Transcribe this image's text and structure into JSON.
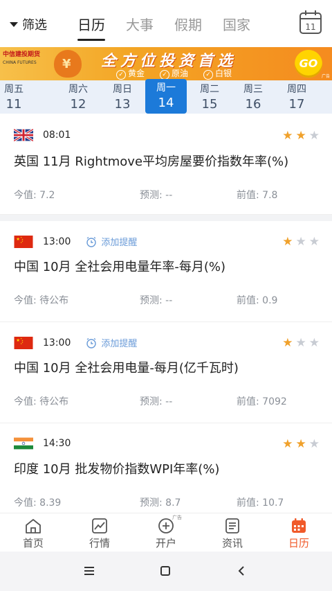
{
  "header": {
    "filter_label": "筛选",
    "tabs": [
      "日历",
      "大事",
      "假期",
      "国家"
    ],
    "calendar_day": "11"
  },
  "banner": {
    "logo_cn": "中信建投期货",
    "logo_en": "CHINA FUTURES",
    "title": "全方位投资首选",
    "tags": [
      "黄金",
      "原油",
      "白银"
    ],
    "go": "GO",
    "ad": "广告"
  },
  "dates": [
    {
      "dow": "周五",
      "day": "11"
    },
    {
      "dow": "周六",
      "day": "12"
    },
    {
      "dow": "周日",
      "day": "13"
    },
    {
      "dow": "周一",
      "day": "14"
    },
    {
      "dow": "周二",
      "day": "15"
    },
    {
      "dow": "周三",
      "day": "16"
    },
    {
      "dow": "周四",
      "day": "17"
    }
  ],
  "events": [
    {
      "flag": "uk",
      "time": "08:01",
      "reminder": "",
      "stars": 2,
      "title": "英国 11月 Rightmove平均房屋要价指数年率(%)",
      "actual": "今值: 7.2",
      "forecast": "预测: --",
      "previous": "前值: 7.8"
    },
    {
      "flag": "cn",
      "time": "13:00",
      "reminder": "添加提醒",
      "stars": 1,
      "title": "中国 10月 全社会用电量年率-每月(%)",
      "actual": "今值: 待公布",
      "forecast": "预测: --",
      "previous": "前值: 0.9"
    },
    {
      "flag": "cn",
      "time": "13:00",
      "reminder": "添加提醒",
      "stars": 1,
      "title": "中国 10月 全社会用电量-每月(亿千瓦时)",
      "actual": "今值: 待公布",
      "forecast": "预测: --",
      "previous": "前值: 7092"
    },
    {
      "flag": "in",
      "time": "14:30",
      "reminder": "",
      "stars": 2,
      "title": "印度 10月 批发物价指数WPI年率(%)",
      "actual": "今值: 8.39",
      "forecast": "预测: 8.7",
      "previous": "前值: 10.7"
    }
  ],
  "bottom_nav": {
    "items": [
      "首页",
      "行情",
      "开户",
      "资讯",
      "日历"
    ],
    "ad_tag": "广告"
  },
  "colors": {
    "accent_blue": "#1c7ad9",
    "nav_active": "#f05a2a",
    "star_on": "#f0a12b",
    "star_off": "#c8ccd3"
  }
}
